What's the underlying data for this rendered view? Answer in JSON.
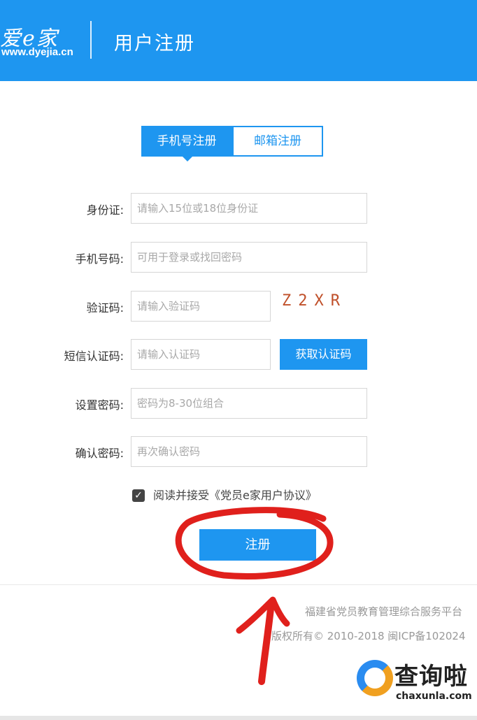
{
  "header": {
    "logo_text": "爱e家",
    "logo_url": "www.dyejia.cn",
    "title": "用户注册"
  },
  "tabs": [
    {
      "label": "手机号注册",
      "active": true
    },
    {
      "label": "邮箱注册",
      "active": false
    }
  ],
  "form": {
    "id_card": {
      "label": "身份证:",
      "placeholder": "请输入15位或18位身份证",
      "value": ""
    },
    "phone": {
      "label": "手机号码:",
      "placeholder": "可用于登录或找回密码",
      "value": ""
    },
    "captcha": {
      "label": "验证码:",
      "placeholder": "请输入验证码",
      "value": "",
      "image_text": "Z2XR"
    },
    "sms_code": {
      "label": "短信认证码:",
      "placeholder": "请输入认证码",
      "value": "",
      "button_label": "获取认证码"
    },
    "password": {
      "label": "设置密码:",
      "placeholder": "密码为8-30位组合",
      "value": ""
    },
    "confirm_password": {
      "label": "确认密码:",
      "placeholder": "再次确认密码",
      "value": ""
    },
    "agreement": {
      "checked": true,
      "text": "阅读并接受《党员e家用户协议》"
    },
    "submit_label": "注册"
  },
  "footer": {
    "org": "福建省党员教育管理综合服务平台",
    "copyright": "版权所有© 2010-2018 闽ICP备102024"
  },
  "watermark": {
    "title": "查询啦",
    "url": "chaxunla.com"
  },
  "colors": {
    "brand_blue": "#1e96f0",
    "annotation_red": "#e0201c",
    "captcha_text": "#c0502a"
  }
}
